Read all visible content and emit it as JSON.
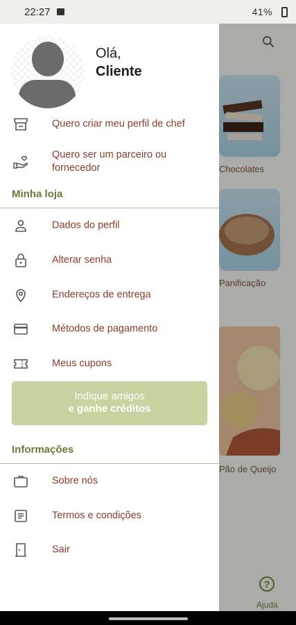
{
  "status_bar": {
    "time": "22:27",
    "battery": "41%"
  },
  "drawer": {
    "greeting": "Olá,",
    "user_name": "Cliente",
    "top_items": [
      {
        "label": "Quero criar meu perfil de chef",
        "icon": "store-icon"
      },
      {
        "label": "Quero ser um parceiro ou fornecedor",
        "icon": "handshake-heart-icon"
      }
    ],
    "section_store": "Minha loja",
    "store_items": [
      {
        "label": "Dados do perfil",
        "icon": "person-icon"
      },
      {
        "label": "Alterar senha",
        "icon": "lock-icon"
      },
      {
        "label": "Endereços de entrega",
        "icon": "location-pin-icon"
      },
      {
        "label": "Métodos de pagamento",
        "icon": "credit-card-icon"
      },
      {
        "label": "Meus cupons",
        "icon": "ticket-icon"
      }
    ],
    "invite_button": {
      "line1": "Indique amigos",
      "line2": "e ganhe créditos"
    },
    "section_info": "Informações",
    "info_items": [
      {
        "label": "Sobre nós",
        "icon": "briefcase-icon"
      },
      {
        "label": "Termos e condições",
        "icon": "document-icon"
      },
      {
        "label": "Sair",
        "icon": "door-exit-icon"
      }
    ]
  },
  "background_page": {
    "categories": [
      "Chocolates",
      "Panificação",
      "Pão de Queijo"
    ],
    "help_label": "Ajuda"
  },
  "colors": {
    "accent_text": "#8a3b2b",
    "section_green": "#6a7a3a",
    "invite_bg": "#c6d3a0"
  }
}
